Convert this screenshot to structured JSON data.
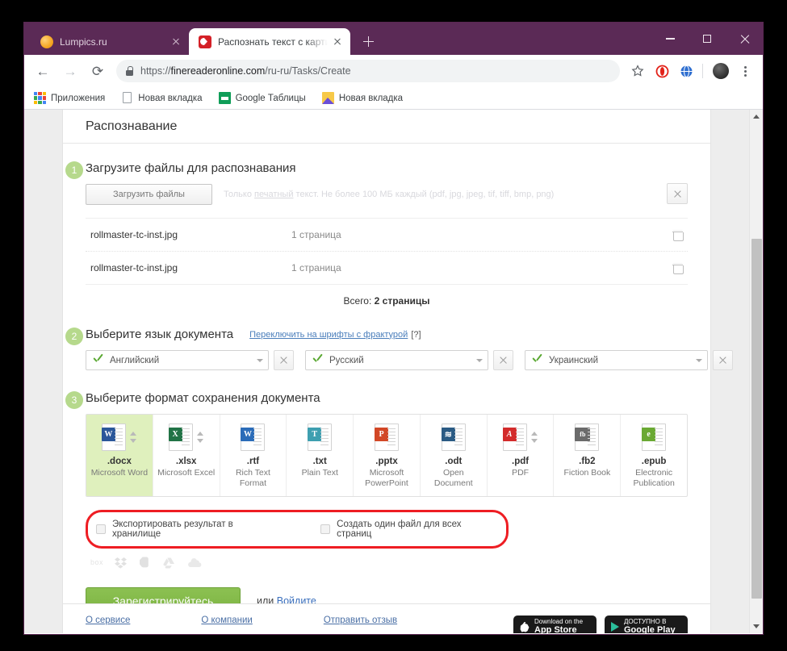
{
  "browser": {
    "tabs": [
      {
        "title": "Lumpics.ru",
        "favicon": "lumpics-favicon",
        "active": false
      },
      {
        "title": "Распознать текст с картинки он",
        "favicon": "abbyy-favicon",
        "active": true
      }
    ],
    "new_tab_label": "+",
    "window_controls": {
      "minimize": "minimize-button",
      "maximize": "maximize-button",
      "close": "close-button"
    },
    "nav": {
      "back": "←",
      "forward": "→",
      "reload": "⟳"
    },
    "omnibox": {
      "scheme": "https://",
      "host": "finereaderonline.com",
      "path": "/ru-ru/Tasks/Create",
      "full_url": "https://finereaderonline.com/ru-ru/Tasks/Create",
      "lock_icon": "lock-icon"
    },
    "toolbar_icons": [
      "star-icon",
      "opera-extension-icon",
      "globe-extension-icon",
      "profile-avatar",
      "chrome-menu-icon"
    ],
    "bookmarks": [
      {
        "label": "Приложения",
        "icon": "apps-grid-icon"
      },
      {
        "label": "Новая вкладка",
        "icon": "page-icon"
      },
      {
        "label": "Google Таблицы",
        "icon": "google-sheets-icon"
      },
      {
        "label": "Новая вкладка",
        "icon": "image-icon"
      }
    ]
  },
  "page": {
    "card_title": "Распознавание",
    "step1": {
      "number": "1",
      "title": "Загрузите файлы для распознавания",
      "upload_button": "Загрузить файлы",
      "hint_prefix": "Только ",
      "hint_underlined": "печатный",
      "hint_suffix": " текст. Не более 100 МБ каждый (pdf, jpg, jpeg, tif, tiff, bmp, png)",
      "clear_button": "clear-all-button",
      "files": [
        {
          "name": "rollmaster-tc-inst.jpg",
          "pages": "1 страница"
        },
        {
          "name": "rollmaster-tc-inst.jpg",
          "pages": "1 страница"
        }
      ],
      "total_label": "Всего:",
      "total_value": "2 страницы"
    },
    "step2": {
      "number": "2",
      "title": "Выберите язык документа",
      "fraktur_link": "Переключить на шрифты с фрактурой",
      "fraktur_help": "[?]",
      "languages": [
        "Английский",
        "Русский",
        "Украинский"
      ]
    },
    "step3": {
      "number": "3",
      "title": "Выберите формат сохранения документа",
      "formats": [
        {
          "ext": ".docx",
          "desc": "Microsoft Word",
          "badge": "W",
          "badge_color": "#2b579a",
          "selected": true,
          "spinner": true
        },
        {
          "ext": ".xlsx",
          "desc": "Microsoft Excel",
          "badge": "X",
          "badge_color": "#217346",
          "selected": false,
          "spinner": true
        },
        {
          "ext": ".rtf",
          "desc": "Rich Text Format",
          "badge": "W",
          "badge_color": "#2b6cb8",
          "selected": false,
          "spinner": false
        },
        {
          "ext": ".txt",
          "desc": "Plain Text",
          "badge": "T",
          "badge_color": "#3e9fb0",
          "selected": false,
          "spinner": false
        },
        {
          "ext": ".pptx",
          "desc": "Microsoft PowerPoint",
          "badge": "P",
          "badge_color": "#d24726",
          "selected": false,
          "spinner": false
        },
        {
          "ext": ".odt",
          "desc": "Open Document",
          "badge": "≋",
          "badge_color": "#2b5b84",
          "selected": false,
          "spinner": false
        },
        {
          "ext": ".pdf",
          "desc": "PDF",
          "badge": "A",
          "badge_color": "#d32b2b",
          "selected": false,
          "spinner": true
        },
        {
          "ext": ".fb2",
          "desc": "Fiction Book",
          "badge": "fb",
          "badge_color": "#6b6b6b",
          "selected": false,
          "spinner": false
        },
        {
          "ext": ".epub",
          "desc": "Electronic Publication",
          "badge": "e",
          "badge_color": "#6aa933",
          "selected": false,
          "spinner": false
        }
      ]
    },
    "options": {
      "export_label": "Экспортировать результат в хранилище",
      "single_file_label": "Создать один файл для всех страниц",
      "highlight_color": "#ee1d23",
      "cloud_services": [
        "box",
        "dropbox-icon",
        "evernote-icon",
        "google-drive-icon",
        "onedrive-icon"
      ]
    },
    "actions": {
      "register_button": "Зарегистрируйтесь",
      "or_text": "или",
      "login_link": "Войдите"
    },
    "footer": {
      "links": [
        "О сервисе",
        "О компании",
        "Отправить отзыв"
      ],
      "badges": [
        {
          "small": "Download on the",
          "big": "App Store"
        },
        {
          "small": "ДОСТУПНО В",
          "big": "Google Play"
        }
      ]
    }
  },
  "colors": {
    "browser_chrome": "#5b2a56",
    "accent_green": "#8cc152",
    "selected_format_bg": "#dff0bd",
    "highlight_red": "#ee1d23",
    "link_blue": "#4a7ebb"
  }
}
